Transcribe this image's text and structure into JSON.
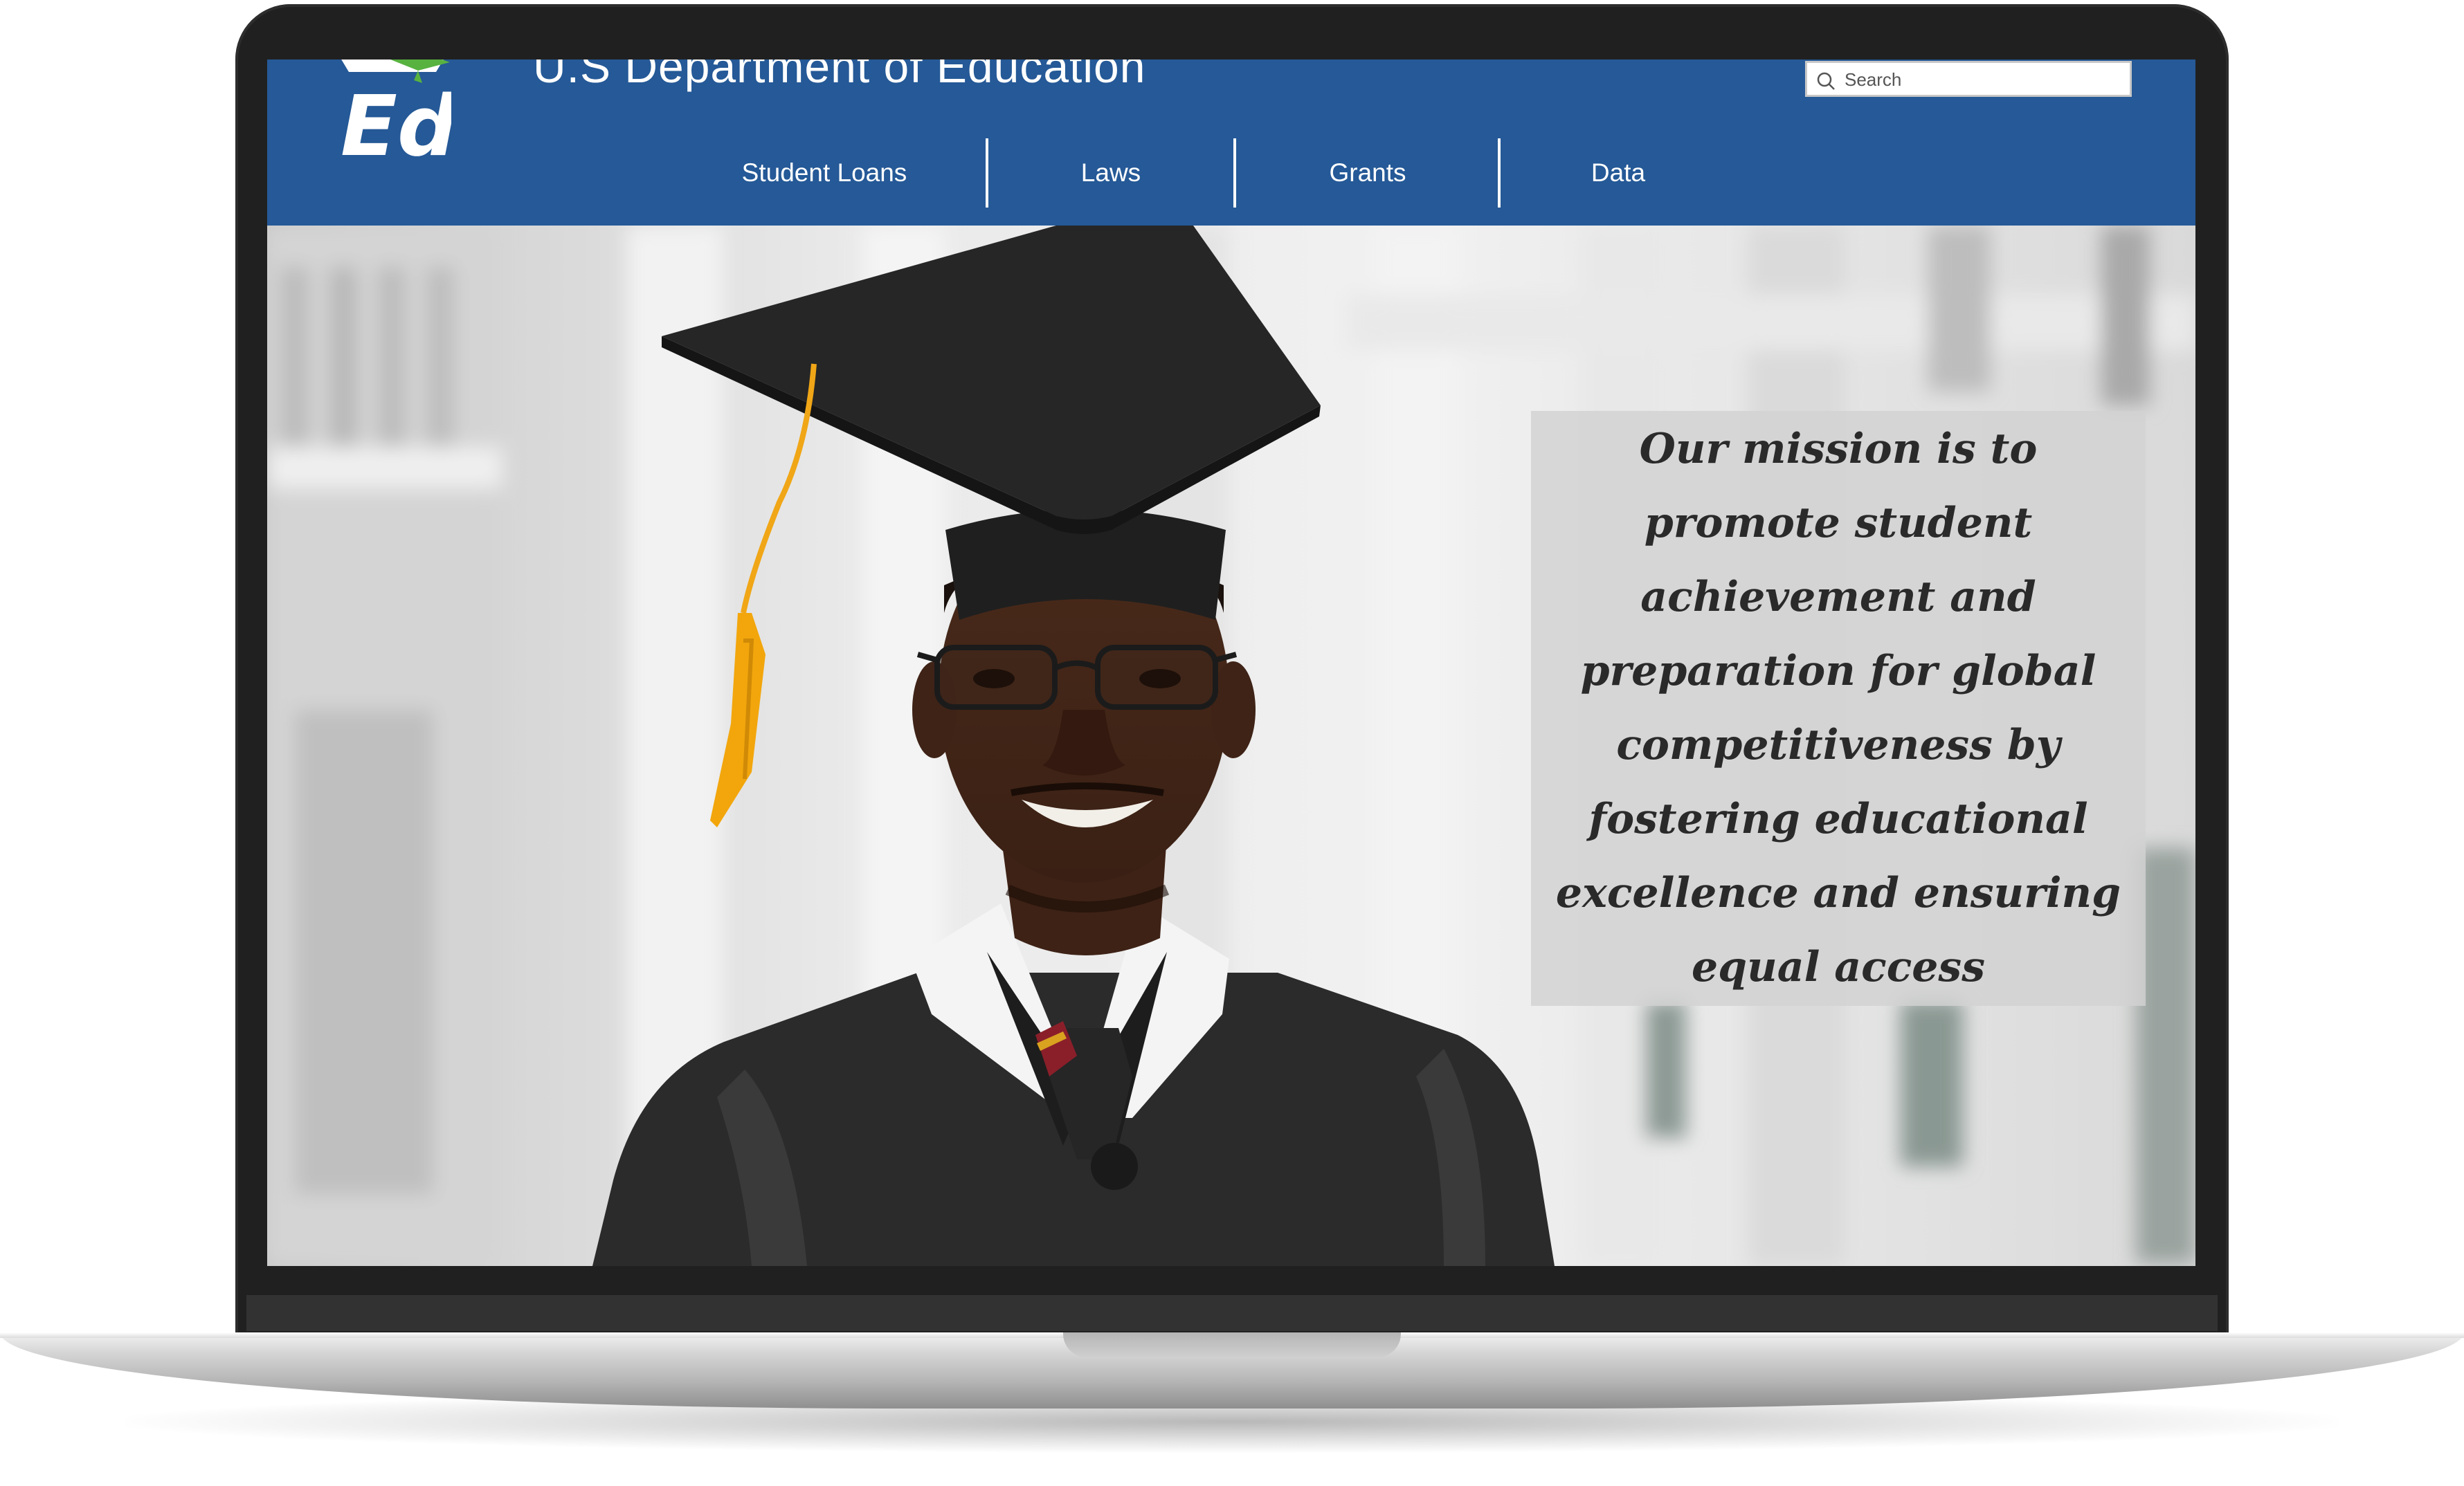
{
  "header": {
    "title": "U.S Department of Education",
    "logo_text": "Ed",
    "search": {
      "placeholder": "Search"
    }
  },
  "nav": {
    "items": [
      {
        "label": "Student Loans"
      },
      {
        "label": "Laws"
      },
      {
        "label": "Grants"
      },
      {
        "label": "Data"
      }
    ]
  },
  "hero": {
    "mission": "Our mission is to promote student achievement and preparation for global competitiveness by fostering educational excellence and ensuring equal access"
  },
  "colors": {
    "header_bg": "#255997",
    "logo_cap_green": "#57b23f",
    "tassel": "#f2a60c"
  }
}
